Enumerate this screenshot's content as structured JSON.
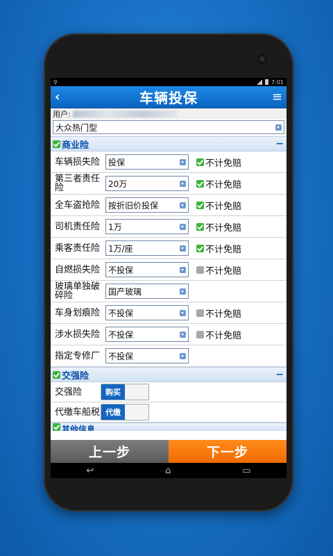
{
  "status": {
    "time": "7:01"
  },
  "header": {
    "title": "车辆投保",
    "back_icon": "back-arrow-icon",
    "menu_icon": "menu-icon"
  },
  "user": {
    "label": "用户:"
  },
  "vehicle_type": {
    "value": "大众热门型"
  },
  "commercial": {
    "title": "商业险",
    "collapse": "−",
    "rows": [
      {
        "label": "车辆损失险",
        "value": "投保",
        "noex": "不计免赔",
        "noex_checked": true
      },
      {
        "label": "第三者责任险",
        "value": "20万",
        "noex": "不计免赔",
        "noex_checked": true
      },
      {
        "label": "全车盗抢险",
        "value": "按折旧价投保",
        "noex": "不计免赔",
        "noex_checked": true
      },
      {
        "label": "司机责任险",
        "value": "1万",
        "noex": "不计免赔",
        "noex_checked": true
      },
      {
        "label": "乘客责任险",
        "value": "1万/座",
        "noex": "不计免赔",
        "noex_checked": true
      },
      {
        "label": "自燃损失险",
        "value": "不投保",
        "noex": "不计免赔",
        "noex_checked": false
      },
      {
        "label": "玻璃单独破碎险",
        "value": "国产玻璃"
      },
      {
        "label": "车身划痕险",
        "value": "不投保",
        "noex": "不计免赔",
        "noex_checked": false
      },
      {
        "label": "涉水损失险",
        "value": "不投保",
        "noex": "不计免赔",
        "noex_checked": false
      },
      {
        "label": "指定专修厂",
        "value": "不投保"
      }
    ]
  },
  "compulsory": {
    "title": "交强险",
    "collapse": "−",
    "rows": [
      {
        "label": "交强险",
        "toggle": "购买"
      },
      {
        "label": "代缴车船税",
        "toggle": "代缴"
      }
    ]
  },
  "other": {
    "title": "其他信息"
  },
  "buttons": {
    "prev": "上一步",
    "next": "下一步"
  },
  "nav": {
    "back": "↩",
    "home": "⌂",
    "recent": "▭"
  },
  "colors": {
    "title_bar": "#0a63c0",
    "next_button": "#f26b00",
    "prev_button": "#5a5a5a",
    "check": "#3cb43c"
  }
}
